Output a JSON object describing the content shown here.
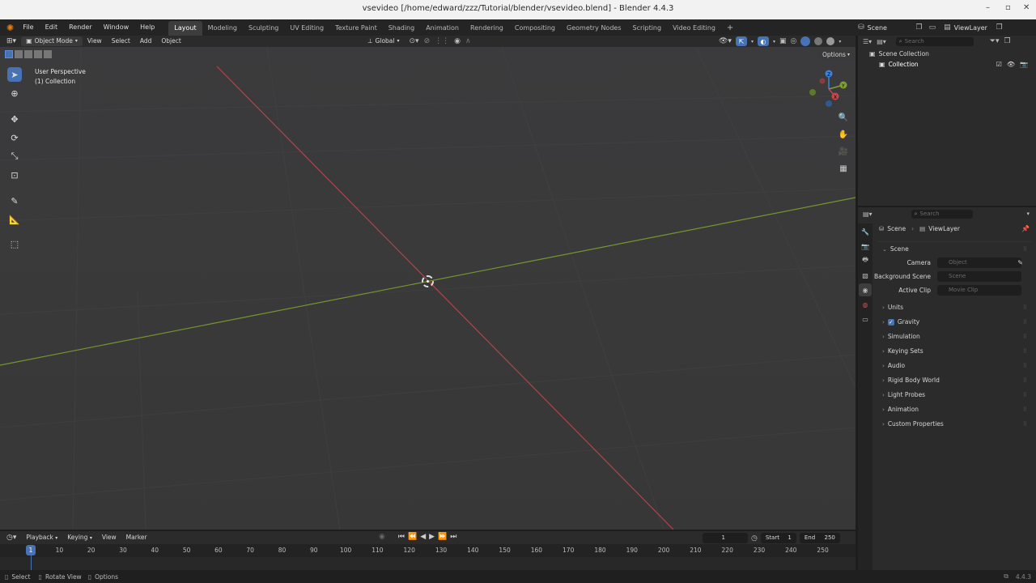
{
  "window": {
    "title": "vsevideo [/home/edward/zzz/Tutorial/blender/vsevideo.blend] - Blender 4.4.3",
    "minimize": "–",
    "maximize": "▫",
    "close": "✕"
  },
  "menu": [
    "File",
    "Edit",
    "Render",
    "Window",
    "Help"
  ],
  "workspaces": [
    "Layout",
    "Modeling",
    "Sculpting",
    "UV Editing",
    "Texture Paint",
    "Shading",
    "Animation",
    "Rendering",
    "Compositing",
    "Geometry Nodes",
    "Scripting",
    "Video Editing"
  ],
  "workspace_add": "+",
  "topright": {
    "scene": "Scene",
    "viewlayer": "ViewLayer"
  },
  "viewport_header": {
    "mode": "Object Mode",
    "menus": [
      "View",
      "Select",
      "Add",
      "Object"
    ],
    "orientation": "Global",
    "options": "Options"
  },
  "viewport": {
    "perspective": "User Perspective",
    "collection": "(1) Collection",
    "gizmo": {
      "x": "X",
      "y": "Y",
      "z": "Z"
    }
  },
  "outliner": {
    "search_placeholder": "Search",
    "scene_collection": "Scene Collection",
    "collection": "Collection"
  },
  "properties": {
    "search_placeholder": "Search",
    "breadcrumb": {
      "scene": "Scene",
      "viewlayer": "ViewLayer"
    },
    "panel_title": "Scene",
    "fields": [
      {
        "label": "Camera",
        "placeholder": "Object"
      },
      {
        "label": "Background Scene",
        "placeholder": "Scene"
      },
      {
        "label": "Active Clip",
        "placeholder": "Movie Clip"
      }
    ],
    "sections": [
      "Units",
      "Gravity",
      "Simulation",
      "Keying Sets",
      "Audio",
      "Rigid Body World",
      "Light Probes",
      "Animation",
      "Custom Properties"
    ],
    "gravity_checked": true
  },
  "timeline": {
    "menus": [
      "Playback",
      "Keying",
      "View",
      "Marker"
    ],
    "current_frame": "1",
    "start_label": "Start",
    "start": "1",
    "end_label": "End",
    "end": "250",
    "ruler": [
      "10",
      "20",
      "30",
      "40",
      "50",
      "60",
      "70",
      "80",
      "90",
      "100",
      "110",
      "120",
      "130",
      "140",
      "150",
      "160",
      "170",
      "180",
      "190",
      "200",
      "210",
      "220",
      "230",
      "240",
      "250"
    ],
    "playhead": "1"
  },
  "status": {
    "select": "Select",
    "rotate": "Rotate View",
    "options": "Options",
    "version": "4.4.3"
  },
  "colors": {
    "accent": "#4772b3",
    "x_axis": "#c7464f",
    "y_axis": "#7ea02f",
    "z_axis": "#3b82d8"
  }
}
